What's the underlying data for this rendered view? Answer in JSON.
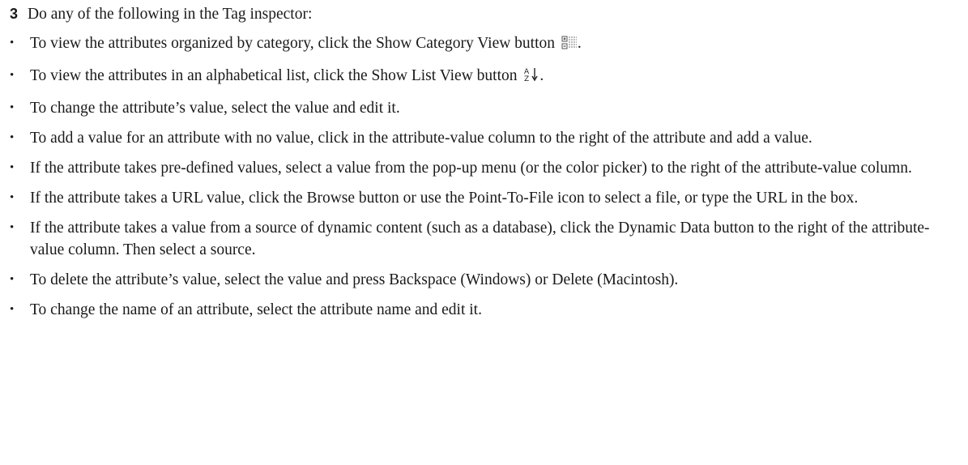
{
  "step": {
    "number": "3",
    "text": "Do any of the following in the Tag inspector:"
  },
  "bullets": [
    {
      "text": "To view the attributes organized by category, click the Show Category View button",
      "icon": "category-view-icon",
      "suffix": "."
    },
    {
      "text": "To view the attributes in an alphabetical list, click the Show List View button",
      "icon": "sort-az-icon",
      "suffix": "."
    },
    {
      "text": "To change the attribute’s value, select the value and edit it."
    },
    {
      "text": "To add a value for an attribute with no value, click in the attribute-value column to the right of the attribute and add a value."
    },
    {
      "text": "If the attribute takes pre-defined values, select a value from the pop-up menu (or the color picker) to the right of the attribute-value column."
    },
    {
      "text": "If the attribute takes a URL value, click the Browse button or use the Point-To-File icon to select a file, or type the URL in the box."
    },
    {
      "text": "If the attribute takes a value from a source of dynamic content (such as a database), click the Dynamic Data button to the right of the attribute-value column. Then select a source."
    },
    {
      "text": "To delete the attribute’s value, select the value and press Backspace (Windows) or Delete (Macintosh)."
    },
    {
      "text": "To change the name of an attribute, select the attribute name and edit it."
    }
  ],
  "bullet_glyph": "•"
}
